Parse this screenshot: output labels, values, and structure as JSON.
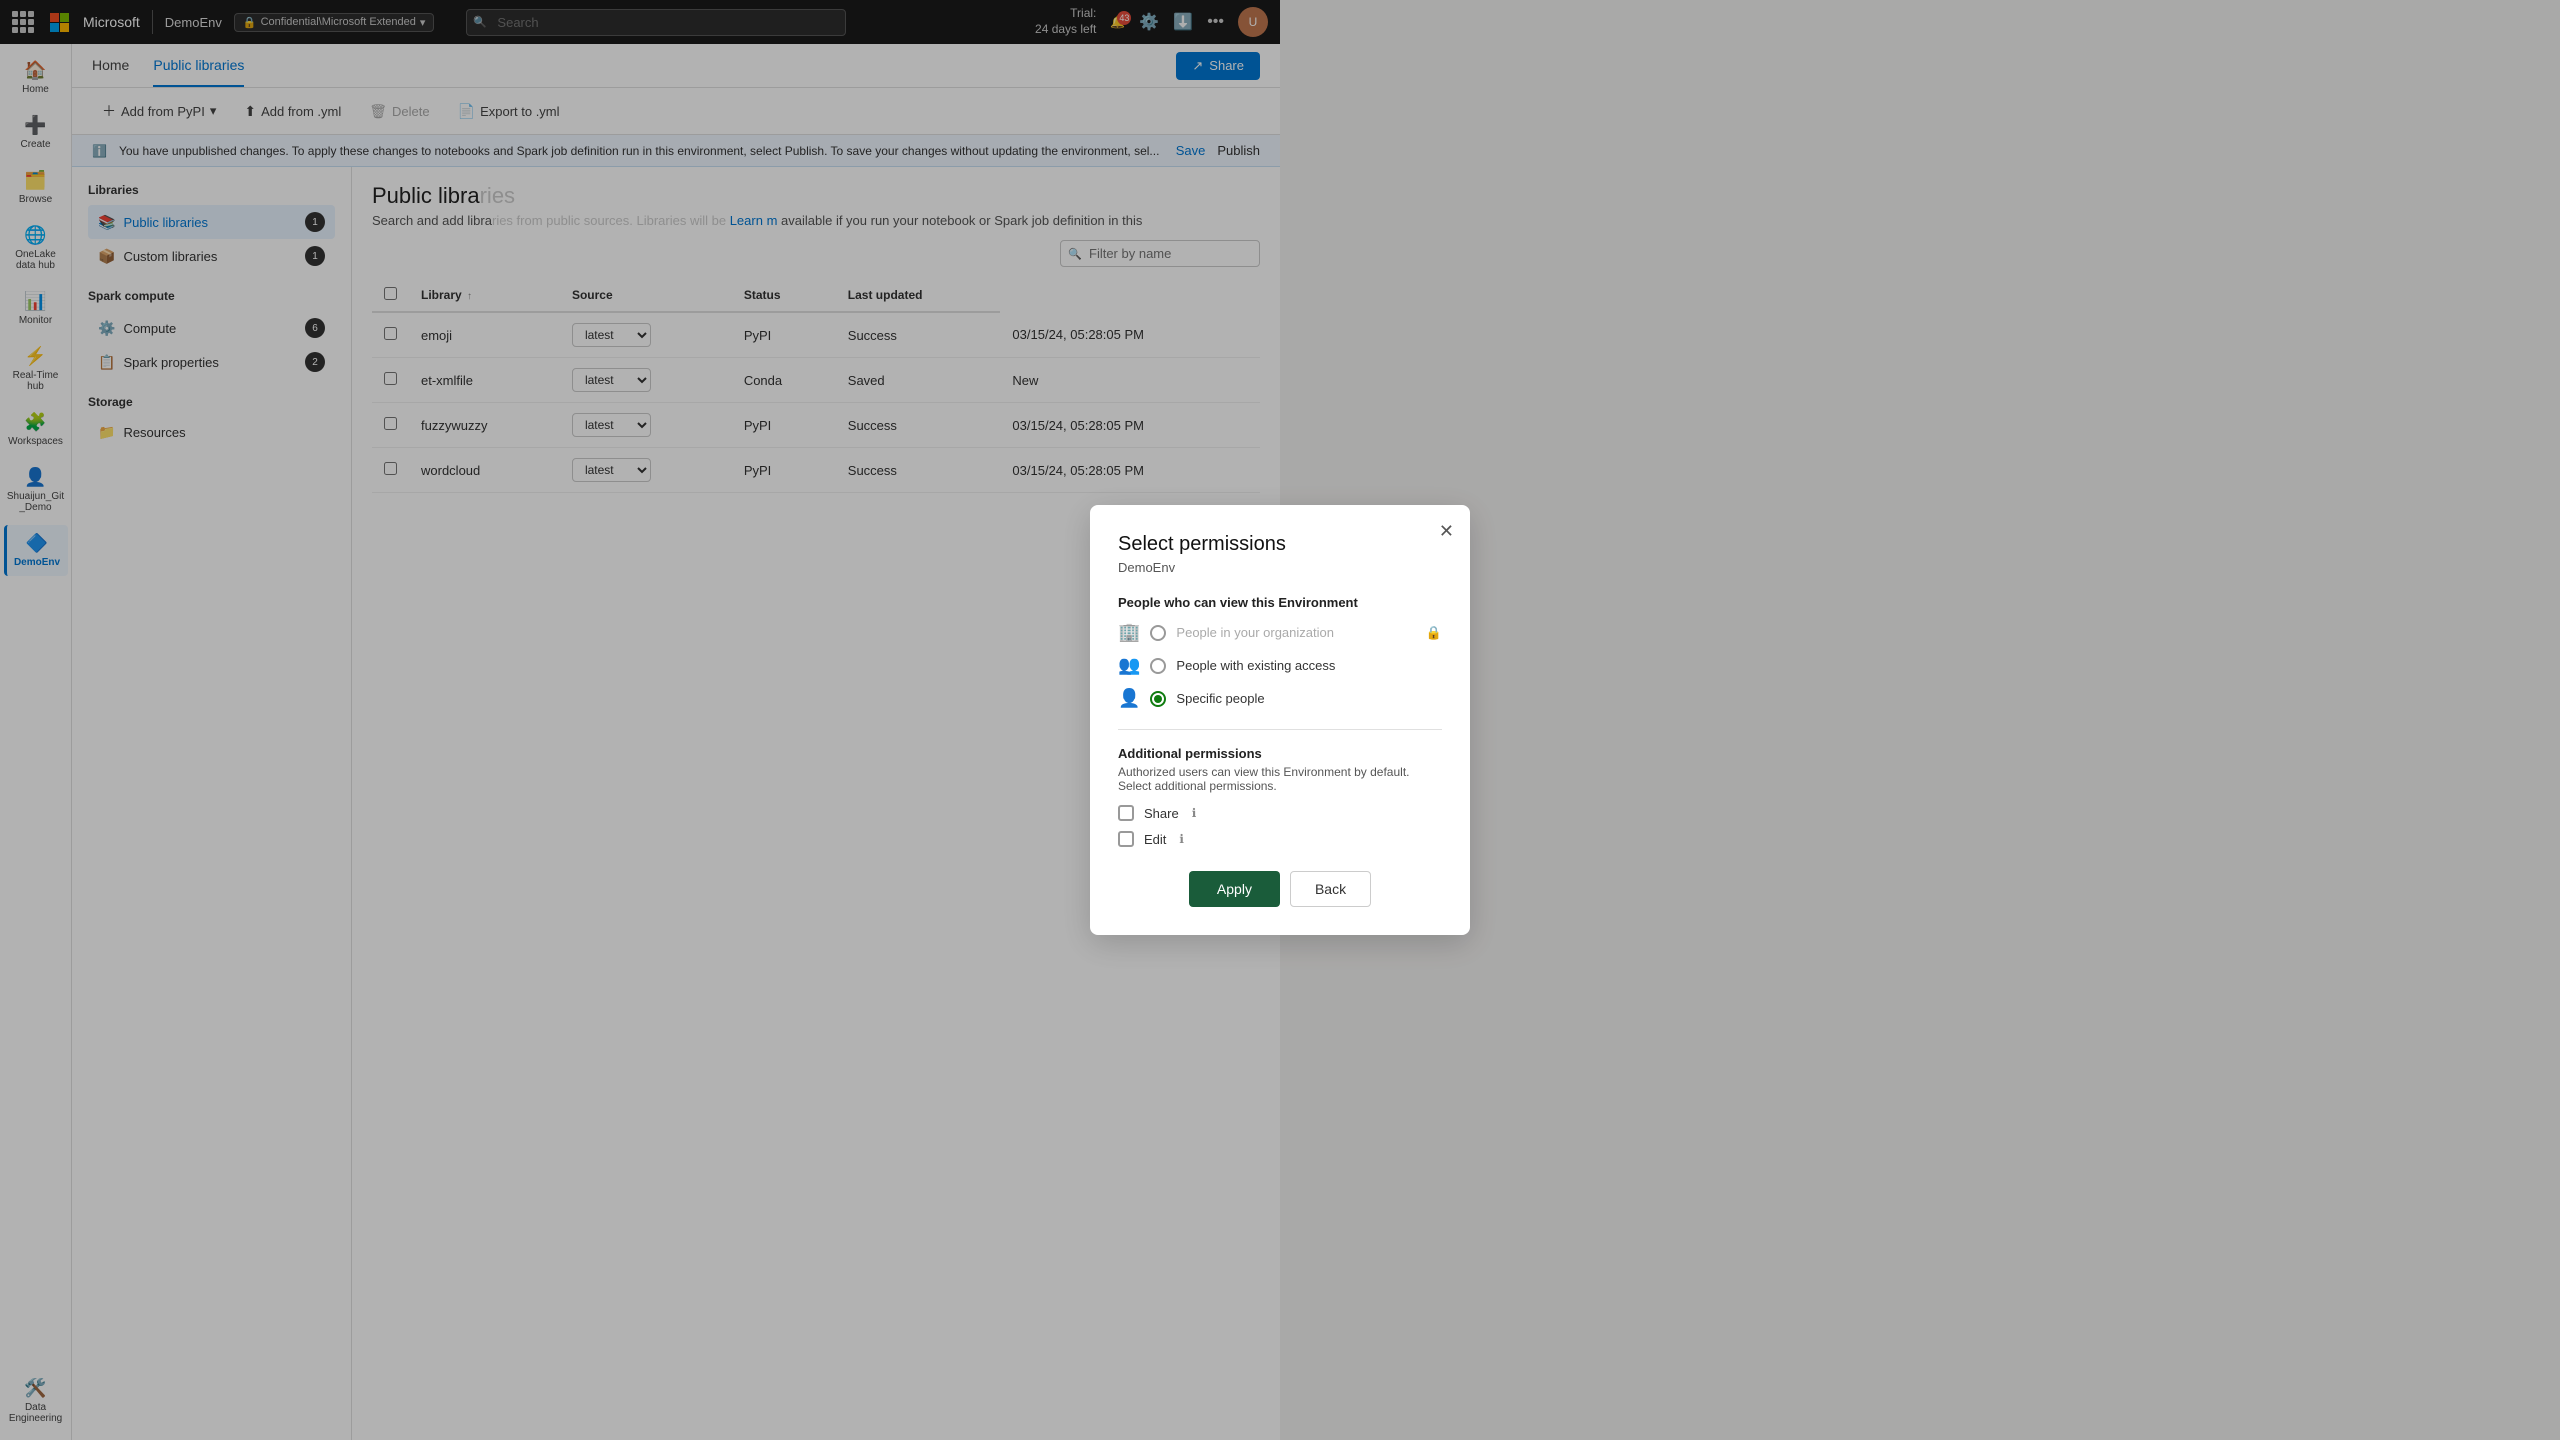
{
  "topbar": {
    "env_name": "DemoEnv",
    "sensitivity": "Confidential\\Microsoft Extended",
    "search_placeholder": "Search",
    "trial_line1": "Trial:",
    "trial_line2": "24 days left",
    "notif_count": "43"
  },
  "sec_nav": {
    "items": [
      "Home",
      "Public libraries"
    ],
    "active": "Public libraries",
    "share_label": "Share"
  },
  "toolbar": {
    "add_pypi": "Add from PyPI",
    "add_yml": "Add from .yml",
    "delete": "Delete",
    "export_yml": "Export to .yml"
  },
  "info_bar": {
    "text": "You have unpublished changes. To apply these changes to notebooks and Spark job definition run in this environment, select Publish. To save your changes without updating the environment, sel...",
    "save_label": "Save",
    "publish_label": "Publish"
  },
  "left_panel": {
    "libraries_title": "Libraries",
    "items": [
      {
        "label": "Public libraries",
        "icon": "📚",
        "badge": "1",
        "selected": true
      },
      {
        "label": "Custom libraries",
        "icon": "📦",
        "badge": "1",
        "selected": false
      }
    ],
    "spark_title": "Spark compute",
    "spark_items": [
      {
        "label": "Compute",
        "icon": "⚙️",
        "badge": "6"
      },
      {
        "label": "Spark properties",
        "icon": "📋",
        "badge": "2"
      }
    ],
    "storage_title": "Storage",
    "storage_items": [
      {
        "label": "Resources",
        "icon": "📁",
        "badge": null
      }
    ]
  },
  "right_panel": {
    "title": "Public libra",
    "desc_start": "Search and add libra",
    "desc_link": "Learn m",
    "desc_end": "available if you run your notebook or Spark job definition in this",
    "filter_placeholder": "Filter by name",
    "table": {
      "columns": [
        "Library",
        "Source",
        "Status",
        "Last updated"
      ],
      "rows": [
        {
          "name": "emoji",
          "version": "",
          "source": "PyPI",
          "status": "Success",
          "last_updated": "03/15/24, 05:28:05 PM"
        },
        {
          "name": "et-xmlfile",
          "version": "",
          "source": "Conda",
          "status": "Saved",
          "last_updated": "New"
        },
        {
          "name": "fuzzywuzzy",
          "version": "",
          "source": "PyPI",
          "status": "Success",
          "last_updated": "03/15/24, 05:28:05 PM"
        },
        {
          "name": "wordcloud",
          "version": "",
          "source": "PyPI",
          "status": "Success",
          "last_updated": "03/15/24, 05:28:05 PM"
        }
      ]
    }
  },
  "dialog": {
    "title": "Select permissions",
    "subtitle": "DemoEnv",
    "view_section_title": "People who can view this Environment",
    "view_options": [
      {
        "label": "People in your organization",
        "icon": "🏢",
        "radio": "unchecked",
        "disabled": true
      },
      {
        "label": "People with existing access",
        "icon": "👥",
        "radio": "unchecked",
        "disabled": false
      },
      {
        "label": "Specific people",
        "icon": "👤",
        "radio": "checked",
        "disabled": false
      }
    ],
    "add_perm_title": "Additional permissions",
    "add_perm_desc": "Authorized users can view this Environment by default. Select additional permissions.",
    "checkboxes": [
      {
        "label": "Share",
        "checked": false
      },
      {
        "label": "Edit",
        "checked": false
      }
    ],
    "apply_label": "Apply",
    "back_label": "Back"
  },
  "sidebar": {
    "items": [
      {
        "label": "Home",
        "icon": "🏠"
      },
      {
        "label": "Create",
        "icon": "➕"
      },
      {
        "label": "Browse",
        "icon": "🗂️"
      },
      {
        "label": "OneLake data hub",
        "icon": "🌐"
      },
      {
        "label": "Monitor",
        "icon": "📊"
      },
      {
        "label": "Real-Time hub",
        "icon": "⚡"
      },
      {
        "label": "Workspaces",
        "icon": "🧩"
      },
      {
        "label": "Shuaijun_Git _Demo",
        "icon": "👤"
      },
      {
        "label": "DemoEnv",
        "icon": "🔷"
      },
      {
        "label": "Data Engineering",
        "icon": "🛠️"
      }
    ]
  }
}
